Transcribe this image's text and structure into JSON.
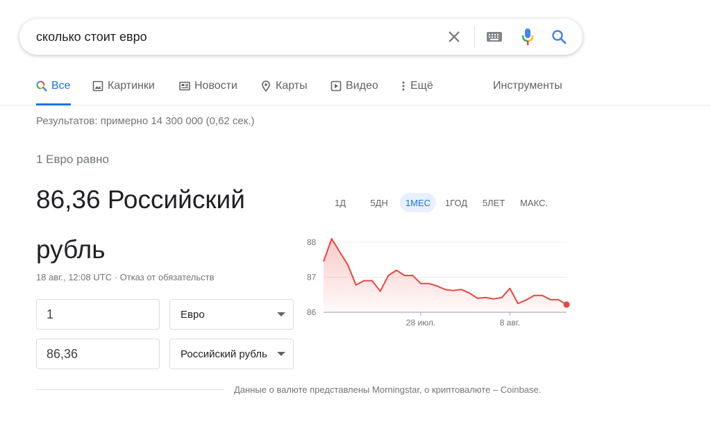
{
  "search": {
    "query": "сколько стоит евро"
  },
  "tabs": [
    {
      "label": "Все",
      "icon": "search-multicolor-icon",
      "active": true
    },
    {
      "label": "Картинки",
      "icon": "image-icon"
    },
    {
      "label": "Новости",
      "icon": "news-icon"
    },
    {
      "label": "Карты",
      "icon": "map-pin-icon"
    },
    {
      "label": "Видео",
      "icon": "play-icon"
    },
    {
      "label": "Ещё",
      "icon": "more-vertical-icon"
    }
  ],
  "tools_label": "Инструменты",
  "result_stats": "Результатов: примерно 14 300 000 (0,62 сек.)",
  "converter": {
    "equals_label": "1 Евро равно",
    "result_value": "86,36 Российский рубль",
    "timestamp": "18 авг., 12:08 UTC",
    "disclaimer": "Отказ от обязательств",
    "from_amount": "1",
    "from_currency": "Евро",
    "to_amount": "86,36",
    "to_currency": "Российский рубль"
  },
  "ranges": [
    {
      "label": "1Д"
    },
    {
      "label": "5ДН"
    },
    {
      "label": "1МЕС",
      "active": true
    },
    {
      "label": "1ГОД"
    },
    {
      "label": "5ЛЕТ"
    },
    {
      "label": "МАКС."
    }
  ],
  "chart_data": {
    "type": "area",
    "y_ticks": [
      "88",
      "87",
      "86"
    ],
    "x_ticks": [
      "28 июл.",
      "8 авг."
    ],
    "ylim": [
      86,
      88
    ],
    "grid": true,
    "line_color": "#e8453c",
    "values": [
      87.45,
      88.1,
      87.72,
      87.35,
      86.78,
      86.9,
      86.9,
      86.6,
      87.05,
      87.2,
      87.05,
      87.05,
      86.82,
      86.82,
      86.75,
      86.65,
      86.62,
      86.65,
      86.55,
      86.4,
      86.42,
      86.38,
      86.42,
      86.68,
      86.25,
      86.35,
      86.48,
      86.48,
      86.36,
      86.36,
      86.22
    ]
  },
  "footer": {
    "source_text": "Данные о валюте представлены Morningstar, о криптовалюте – Coinbase."
  }
}
